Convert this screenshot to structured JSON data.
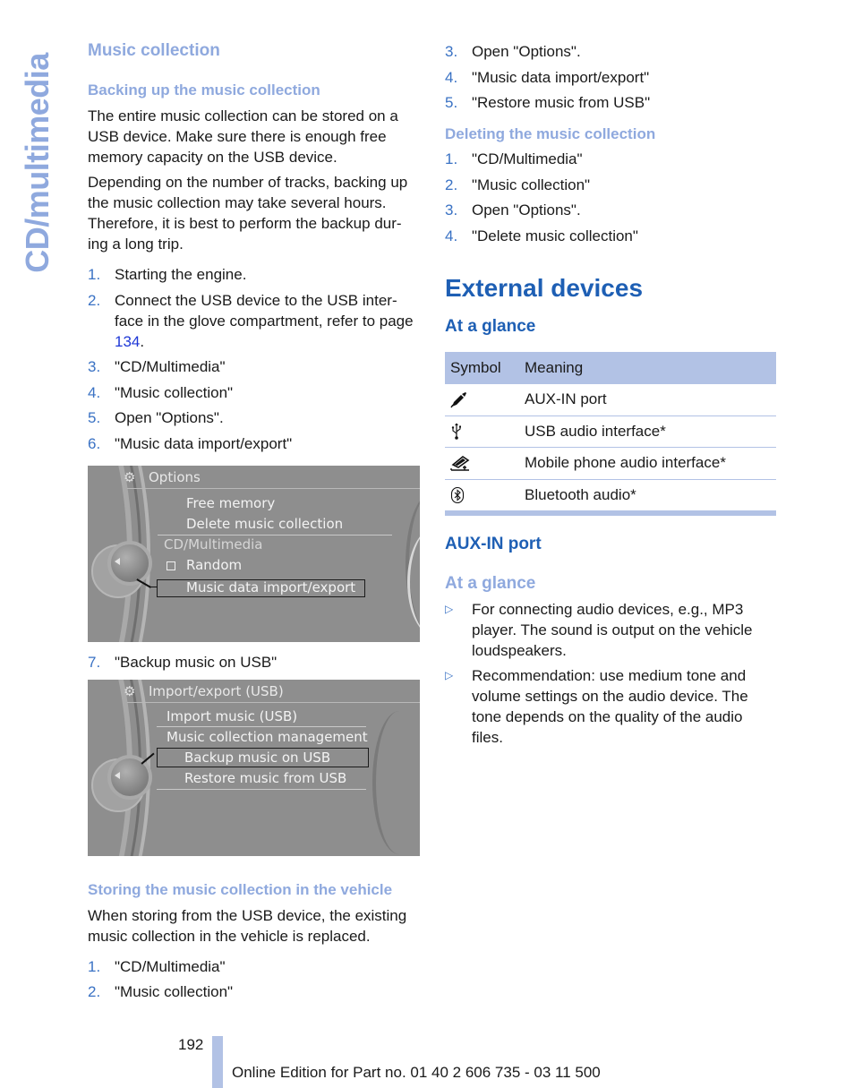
{
  "side_tab": {
    "label": "CD/multimedia"
  },
  "left": {
    "section_title": "Music collection",
    "backup": {
      "title": "Backing up the music collection",
      "para1": "The entire music collection can be stored on a USB device. Make sure there is enough free memory capacity on the USB device.",
      "para2": "Depending on the number of tracks, backing up the music collection may take several hours. Therefore, it is best to perform the backup dur-ing a long trip.",
      "steps": [
        {
          "num": "1.",
          "text": "Starting the engine."
        },
        {
          "num": "2.",
          "text_before": "Connect the USB device to the USB inter-face in the glove compartment, refer to page ",
          "link": "134",
          "text_after": "."
        },
        {
          "num": "3.",
          "text": "\"CD/Multimedia\""
        },
        {
          "num": "4.",
          "text": "\"Music collection\""
        },
        {
          "num": "5.",
          "text": "Open \"Options\"."
        },
        {
          "num": "6.",
          "text": "\"Music data import/export\""
        }
      ],
      "step7": {
        "num": "7.",
        "text": "\"Backup music on USB\""
      }
    },
    "screen1": {
      "title": "Options",
      "items": [
        "Free memory",
        "Delete music collection",
        "CD/Multimedia",
        "Random",
        "Music data import/export"
      ],
      "selected": "Music data import/export"
    },
    "screen2": {
      "title": "Import/export (USB)",
      "items": [
        "Import music (USB)",
        "Music collection management",
        "Backup music on USB",
        "Restore music from USB"
      ],
      "selected": "Backup music on USB"
    },
    "storing": {
      "title": "Storing the music collection in the vehicle",
      "para": "When storing from the USB device, the existing music collection in the vehicle is replaced.",
      "steps": [
        {
          "num": "1.",
          "text": "\"CD/Multimedia\""
        },
        {
          "num": "2.",
          "text": "\"Music collection\""
        }
      ]
    }
  },
  "right": {
    "storing_cont_steps": [
      {
        "num": "3.",
        "text": "Open \"Options\"."
      },
      {
        "num": "4.",
        "text": "\"Music data import/export\""
      },
      {
        "num": "5.",
        "text": "\"Restore music from USB\""
      }
    ],
    "deleting": {
      "title": "Deleting the music collection",
      "steps": [
        {
          "num": "1.",
          "text": "\"CD/Multimedia\""
        },
        {
          "num": "2.",
          "text": "\"Music collection\""
        },
        {
          "num": "3.",
          "text": "Open \"Options\"."
        },
        {
          "num": "4.",
          "text": "\"Delete music collection\""
        }
      ]
    },
    "external": {
      "title": "External devices",
      "at_a_glance": "At a glance",
      "table": {
        "headers": [
          "Symbol",
          "Meaning"
        ],
        "rows": [
          {
            "icon": "aux-plug-icon",
            "meaning": "AUX-IN port"
          },
          {
            "icon": "usb-icon",
            "meaning": "USB audio interface*"
          },
          {
            "icon": "mobile-phone-cradle-icon",
            "meaning": "Mobile phone audio interface*"
          },
          {
            "icon": "bluetooth-icon",
            "meaning": "Bluetooth audio*"
          }
        ]
      }
    },
    "aux": {
      "title": "AUX-IN port",
      "subtitle": "At a glance",
      "bullets": [
        "For connecting audio devices, e.g., MP3 player. The sound is output on the vehicle loudspeakers.",
        "Recommendation: use medium tone and volume settings on the audio device. The tone depends on the quality of the audio files."
      ],
      "bullet_glyph": "▷"
    }
  },
  "footer": {
    "page_number": "192",
    "edition": "Online Edition for Part no. 01 40 2 606 735 - 03 11 500"
  },
  "colors": {
    "heading_light": "#8fa9de",
    "heading_dark": "#1e5fb4",
    "list_number": "#3a72c4",
    "table_header": "#b2c2e5",
    "link": "#1d37d6"
  }
}
